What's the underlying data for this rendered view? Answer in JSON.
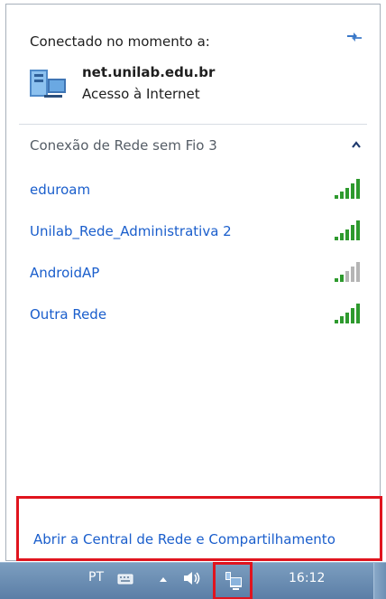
{
  "panel": {
    "connected_label": "Conectado no momento a:",
    "current_network": {
      "name": "net.unilab.edu.br",
      "status": "Acesso à Internet",
      "icon": "server-network-icon"
    },
    "group_header": "Conexão de Rede sem Fio 3",
    "networks": [
      {
        "label": "eduroam",
        "signal_bars": 5
      },
      {
        "label": "Unilab_Rede_Administrativa 2",
        "signal_bars": 5
      },
      {
        "label": "AndroidAP",
        "signal_bars": 2
      },
      {
        "label": "Outra Rede",
        "signal_bars": 5
      }
    ],
    "footer_link": "Abrir a Central de Rede e Compartilhamento"
  },
  "taskbar": {
    "language": "PT",
    "time": "16:12"
  },
  "colors": {
    "link_blue": "#1a5ecc",
    "signal_green": "#2e9a2e",
    "signal_gray": "#b5b5b5",
    "highlight_red": "#e0141e",
    "taskbar_blue": "#6b8fb6"
  }
}
